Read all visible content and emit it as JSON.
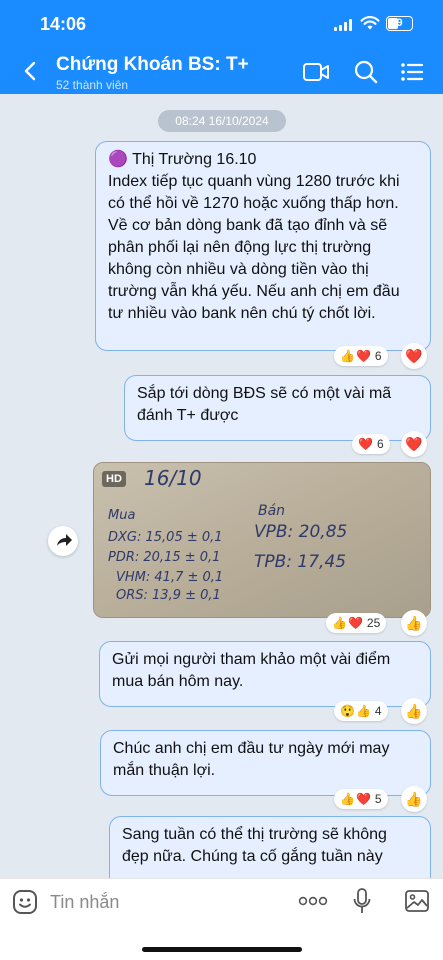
{
  "status": {
    "time": "14:06",
    "battery": "9"
  },
  "header": {
    "title": "Chứng Khoán BS: T+",
    "subtitle": "52 thành viên"
  },
  "chat": {
    "date": "08:24 16/10/2024",
    "messages": [
      {
        "text": "🟣 Thị Trường 16.10\nIndex tiếp tục quanh vùng 1280 trước khi có thể hồi về 1270 hoặc xuống thấp hơn. Về cơ bản dòng bank đã tạo đỉnh và sẽ phân phối lại nên động lực thị trường không còn nhiều và dòng tiền vào thị trường vẫn khá yếu. Nếu anh chị em đầu tư nhiều vào bank nên chú tý chốt lời.",
        "reactions": {
          "emojis": [
            "👍",
            "❤️"
          ],
          "count": "6",
          "button": "❤️"
        }
      },
      {
        "text": "Sắp tới dòng BĐS sẽ có một vài mã đánh T+ được",
        "reactions": {
          "emojis": [
            "❤️"
          ],
          "count": "6",
          "button": "❤️"
        }
      },
      {
        "type": "image",
        "badge": "HD",
        "handwriting": {
          "date": "16/10",
          "buy_label": "Mua",
          "buy": [
            "DXG: 15,05 ± 0,1",
            "PDR: 20,15 ± 0,1",
            "VHM: 41,7 ± 0,1",
            "ORS: 13,9 ± 0,1"
          ],
          "sell_label": "Bán",
          "sell": [
            "VPB: 20,85",
            "TPB: 17,45"
          ]
        },
        "reactions": {
          "emojis": [
            "👍",
            "❤️"
          ],
          "count": "25",
          "button": "👍"
        }
      },
      {
        "text": "Gửi mọi người tham khảo một vài điểm mua bán hôm nay.",
        "reactions": {
          "emojis": [
            "😲",
            "👍"
          ],
          "count": "4",
          "button": "👍"
        }
      },
      {
        "text": "Chúc anh chị em đầu tư ngày mới may mắn thuận lợi.",
        "reactions": {
          "emojis": [
            "👍",
            "❤️"
          ],
          "count": "5",
          "button": "👍"
        }
      },
      {
        "text": "Sang tuần có thể thị trường sẽ không đẹp nữa. Chúng ta cố gắng tuần này"
      }
    ]
  },
  "input": {
    "placeholder": "Tin nhắn"
  },
  "colors": {
    "brand": "#1a8cff",
    "bubble": "#e5efff",
    "bubble_border": "#7fb3ea",
    "background": "#e2e9f1"
  }
}
